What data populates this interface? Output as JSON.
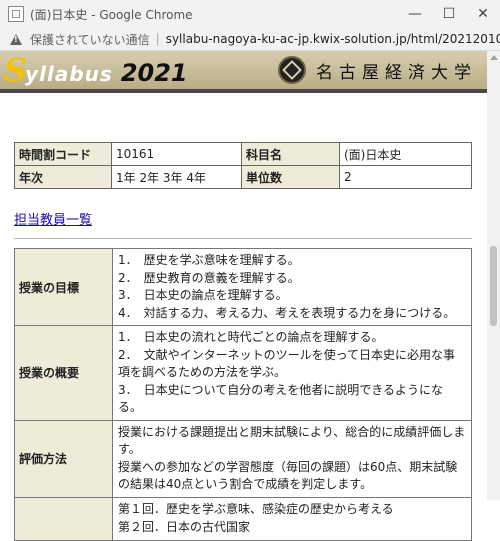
{
  "window": {
    "title": "(面)日本史 - Google Chrome"
  },
  "address": {
    "security_label": "保護されていない通信",
    "url": "syllabu-nagoya-ku-ac-jp.kwix-solution.jp/html/20212010161.htm"
  },
  "banner": {
    "logo_initial": "S",
    "logo_rest": "yllabus",
    "logo_year": "2021",
    "university": "名古屋経済大学"
  },
  "info_table": {
    "rows": [
      {
        "k1": "時間割コード",
        "v1": "10161",
        "k2": "科目名",
        "v2": "(面)日本史"
      },
      {
        "k1": "年次",
        "v1": "1年 2年 3年 4年",
        "k2": "単位数",
        "v2": "2"
      }
    ]
  },
  "instructor_link": "担当教員一覧",
  "sections": {
    "goals": {
      "label": "授業の目標",
      "items": [
        "1．　歴史を学ぶ意味を理解する。",
        "2．　歴史教育の意義を理解する。",
        "3．　日本史の論点を理解する。",
        "4．　対話する力、考える力、考えを表現する力を身につける。"
      ]
    },
    "overview": {
      "label": "授業の概要",
      "items": [
        "1．　日本史の流れと時代ごとの論点を理解する。",
        "2．　文献やインターネットのツールを使って日本史に必用な事項を調べるための方法を学ぶ。",
        "3．　日本史について自分の考えを他者に説明できるようになる。"
      ]
    },
    "evaluation": {
      "label": "評価方法",
      "items": [
        "授業における課題提出と期末試験により、総合的に成績評価します。",
        "授業への参加などの学習態度（毎回の課題）は60点、期末試験の結果は40点という割合で成績を判定します。"
      ]
    },
    "plan": {
      "label": "",
      "items": [
        "第１回．歴史を学ぶ意味、感染症の歴史から考える",
        "第２回．日本の古代国家"
      ]
    }
  }
}
